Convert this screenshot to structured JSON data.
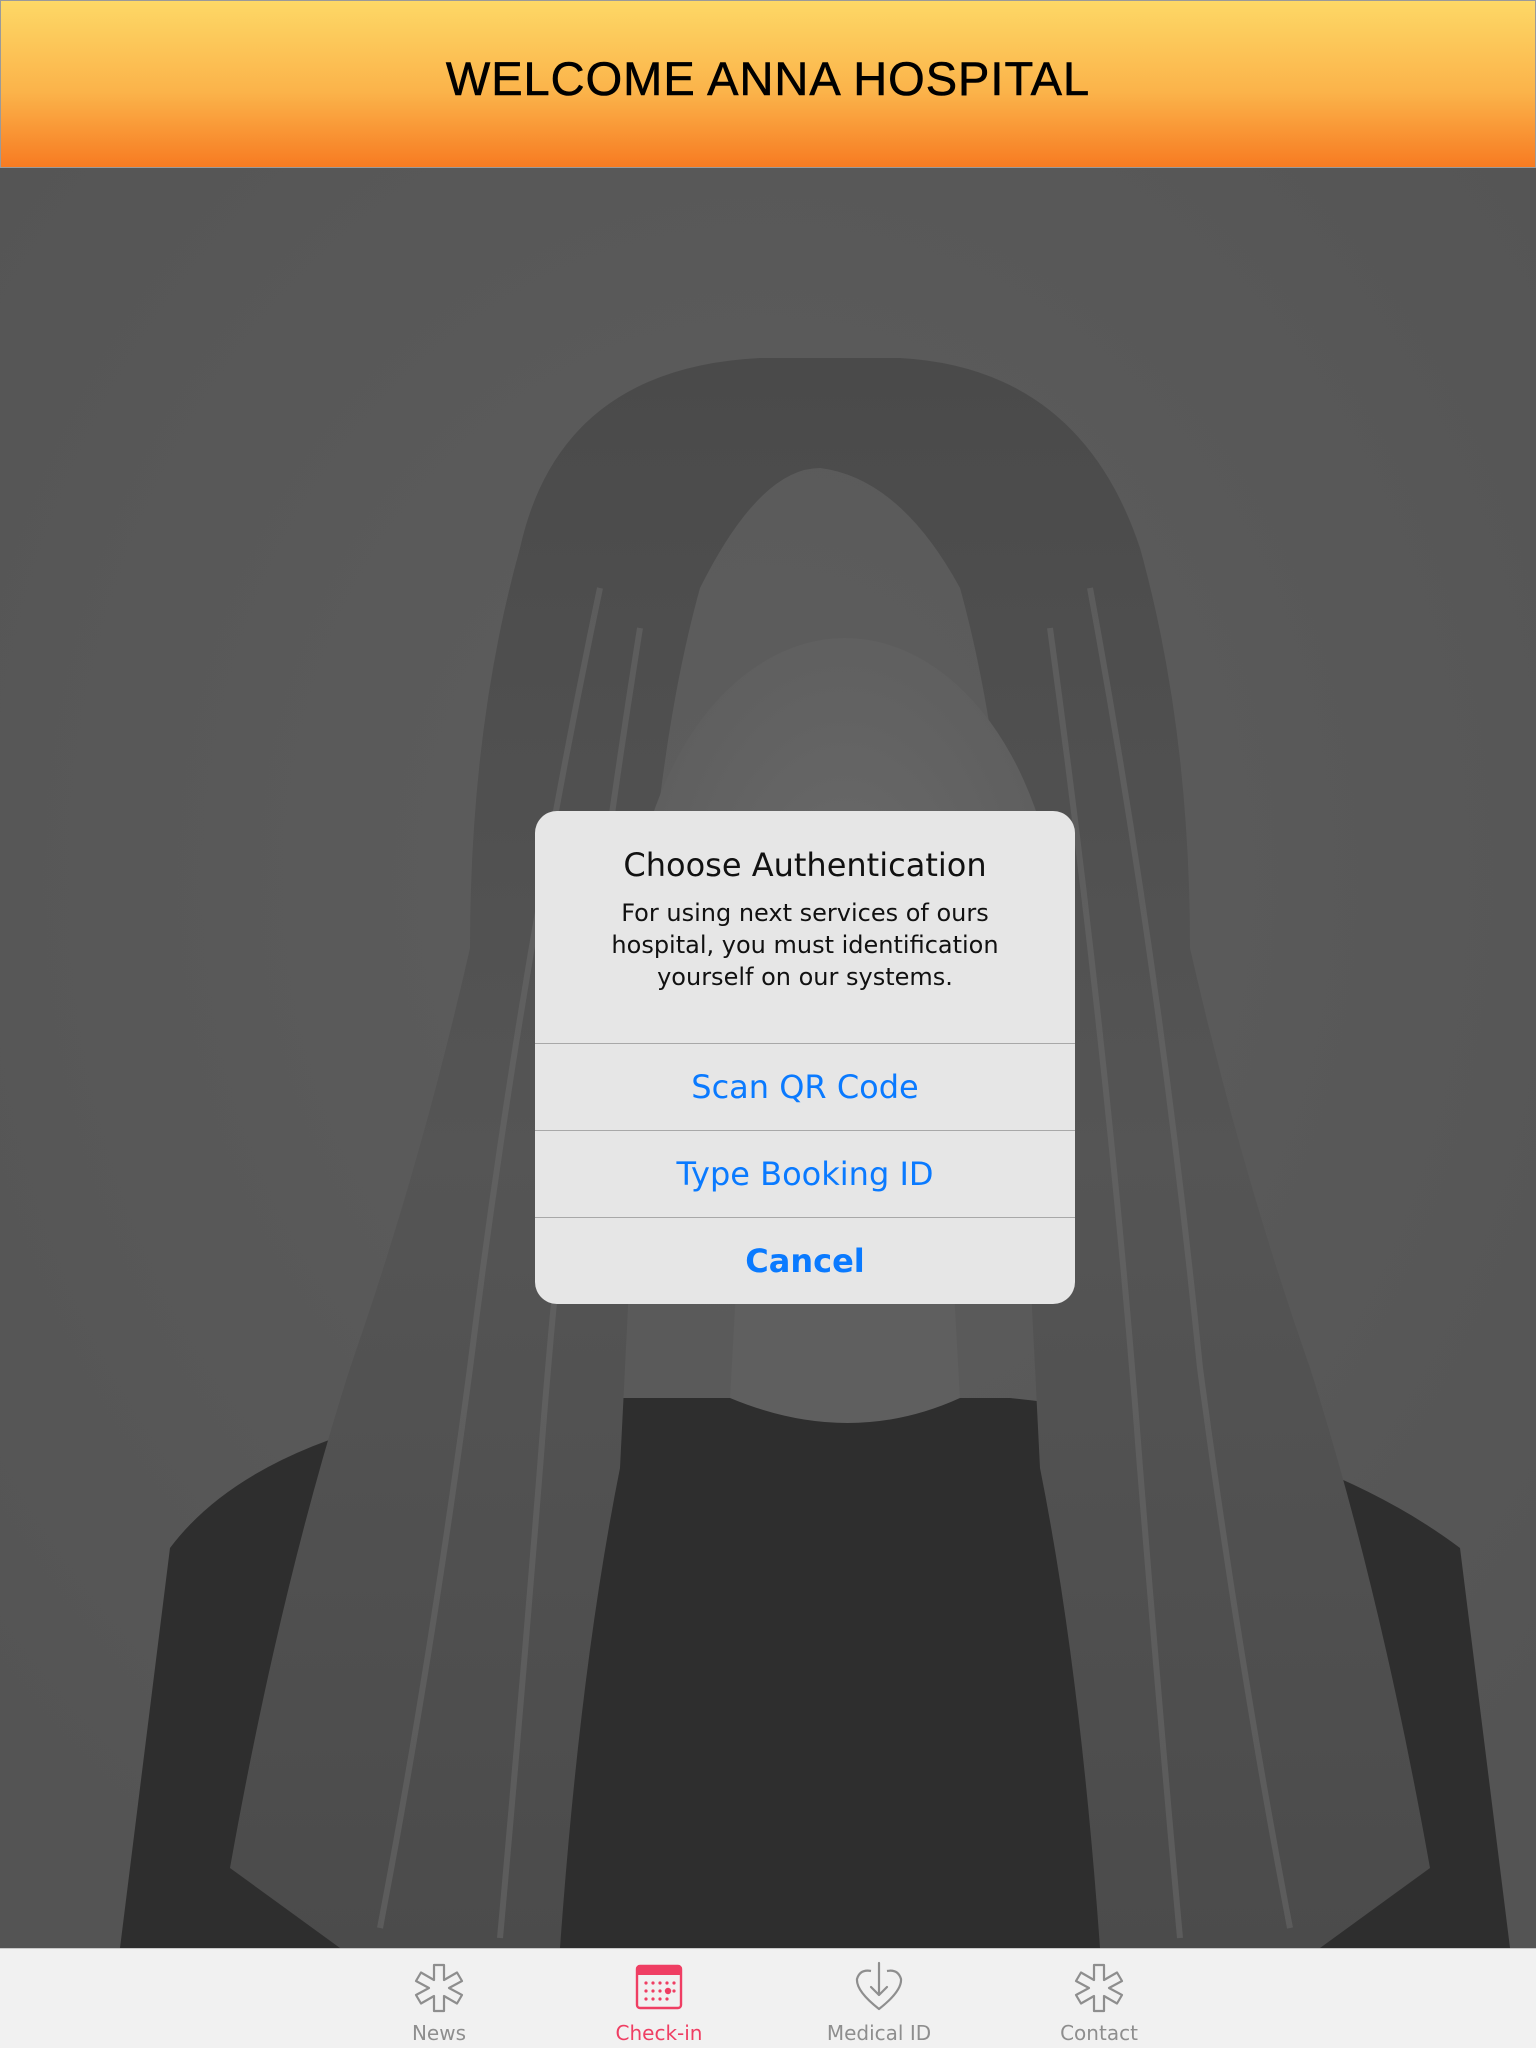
{
  "header": {
    "title": "WELCOME ANNA HOSPITAL"
  },
  "colors": {
    "header_gradient_top": "#fdd866",
    "header_gradient_bottom": "#f77b22",
    "accent_blue": "#0a7aff",
    "tab_active": "#ef3e63",
    "tab_inactive": "#8e8e8e"
  },
  "dialog": {
    "title": "Choose Authentication",
    "message": "For using next services of ours hospital, you must identification yourself on our systems.",
    "buttons": [
      {
        "label": "Scan QR Code"
      },
      {
        "label": "Type Booking ID"
      },
      {
        "label": "Cancel"
      }
    ]
  },
  "tabbar": {
    "tabs": [
      {
        "label": "News",
        "icon": "asterisk-icon",
        "active": false
      },
      {
        "label": "Check-in",
        "icon": "calendar-icon",
        "active": true
      },
      {
        "label": "Medical ID",
        "icon": "heart-download-icon",
        "active": false
      },
      {
        "label": "Contact",
        "icon": "asterisk-icon",
        "active": false
      }
    ]
  }
}
